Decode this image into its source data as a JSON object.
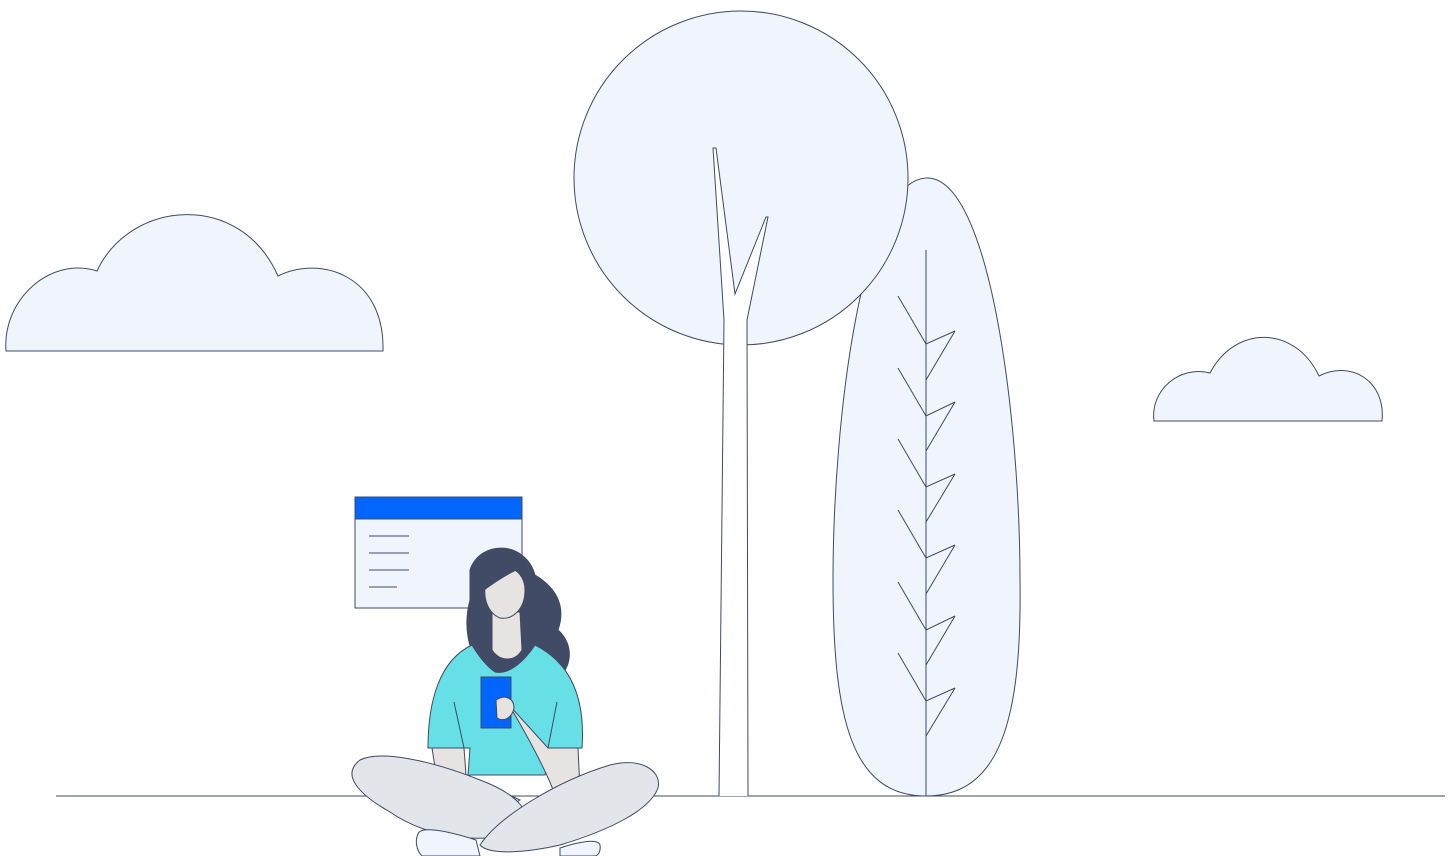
{
  "illustration": {
    "colors": {
      "background": "#ffffff",
      "outline": "#3f4a66",
      "light_fill": "#f0f4fd",
      "accent_blue": "#0066ff",
      "shirt": "#66e0e6",
      "hair": "#414b66",
      "skin": "#e6e3e0",
      "pants": "#e2e5ea"
    },
    "elements": [
      "cloud",
      "cloud",
      "round-tree",
      "tall-tree",
      "ground-line",
      "browser-window",
      "person",
      "phone"
    ]
  }
}
